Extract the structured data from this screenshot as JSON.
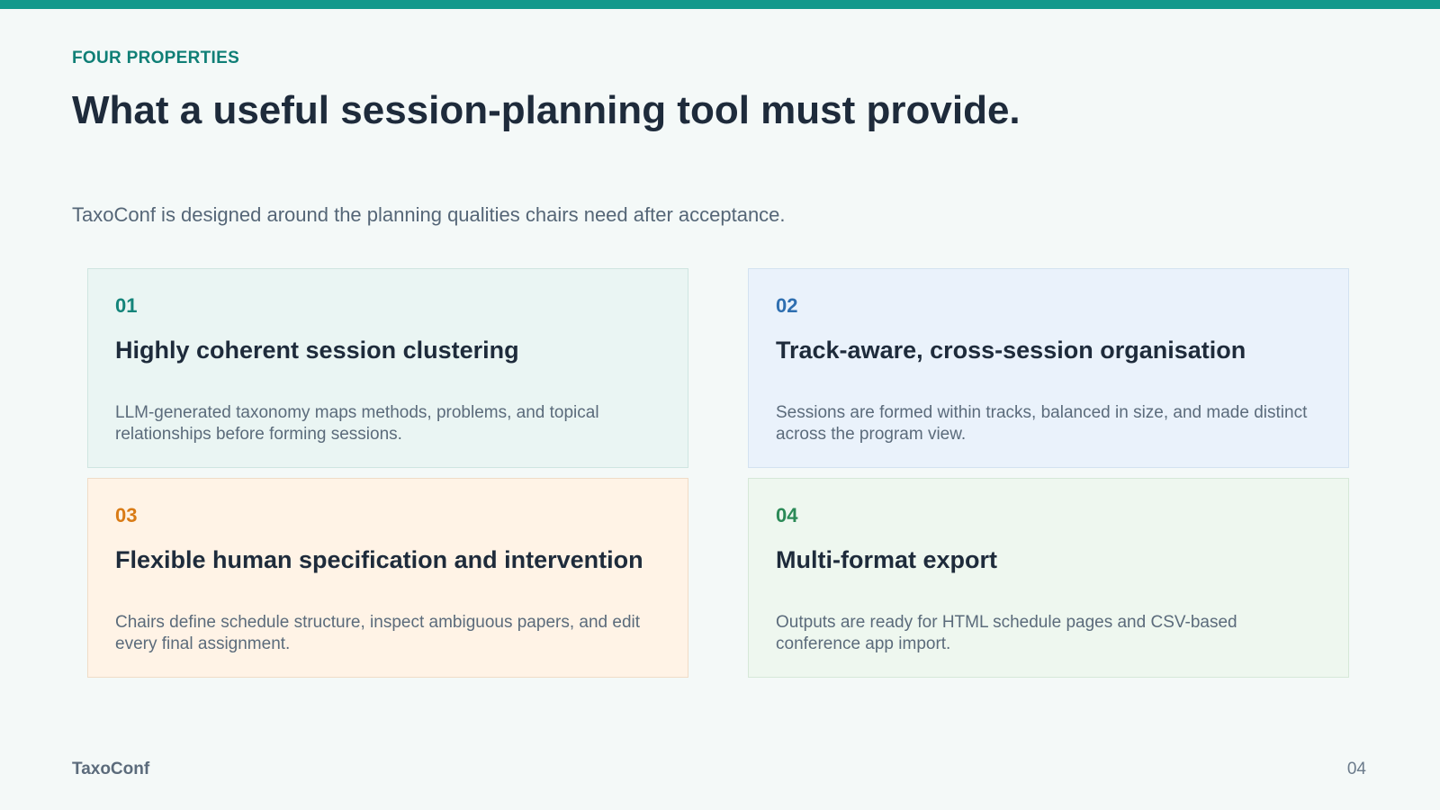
{
  "slide": {
    "eyebrow": "FOUR PROPERTIES",
    "title": "What a useful session-planning tool must provide.",
    "subtitle": "TaxoConf is designed around the planning qualities chairs need after acceptance."
  },
  "cards": [
    {
      "number": "01",
      "title": "Highly coherent session clustering",
      "description": "LLM-generated taxonomy maps methods, problems, and topical relationships before forming sessions.",
      "accent": "#14847a",
      "background": "#eaf5f3"
    },
    {
      "number": "02",
      "title": "Track-aware, cross-session organisation",
      "description": "Sessions are formed within tracks, balanced in size, and made distinct across the program view.",
      "accent": "#2f6fb0",
      "background": "#eaf2fb"
    },
    {
      "number": "03",
      "title": "Flexible human specification and intervention",
      "description": "Chairs define schedule structure, inspect ambiguous papers, and edit every final assignment.",
      "accent": "#d97b16",
      "background": "#fff3e6"
    },
    {
      "number": "04",
      "title": "Multi-format export",
      "description": "Outputs are ready for HTML schedule pages and CSV-based conference app import.",
      "accent": "#2b8a57",
      "background": "#eef7ef"
    }
  ],
  "footer": {
    "brand": "TaxoConf",
    "page_number": "04"
  },
  "colors": {
    "top_bar": "#12998c",
    "background": "#f4f9f8",
    "heading": "#1e2b3b"
  }
}
